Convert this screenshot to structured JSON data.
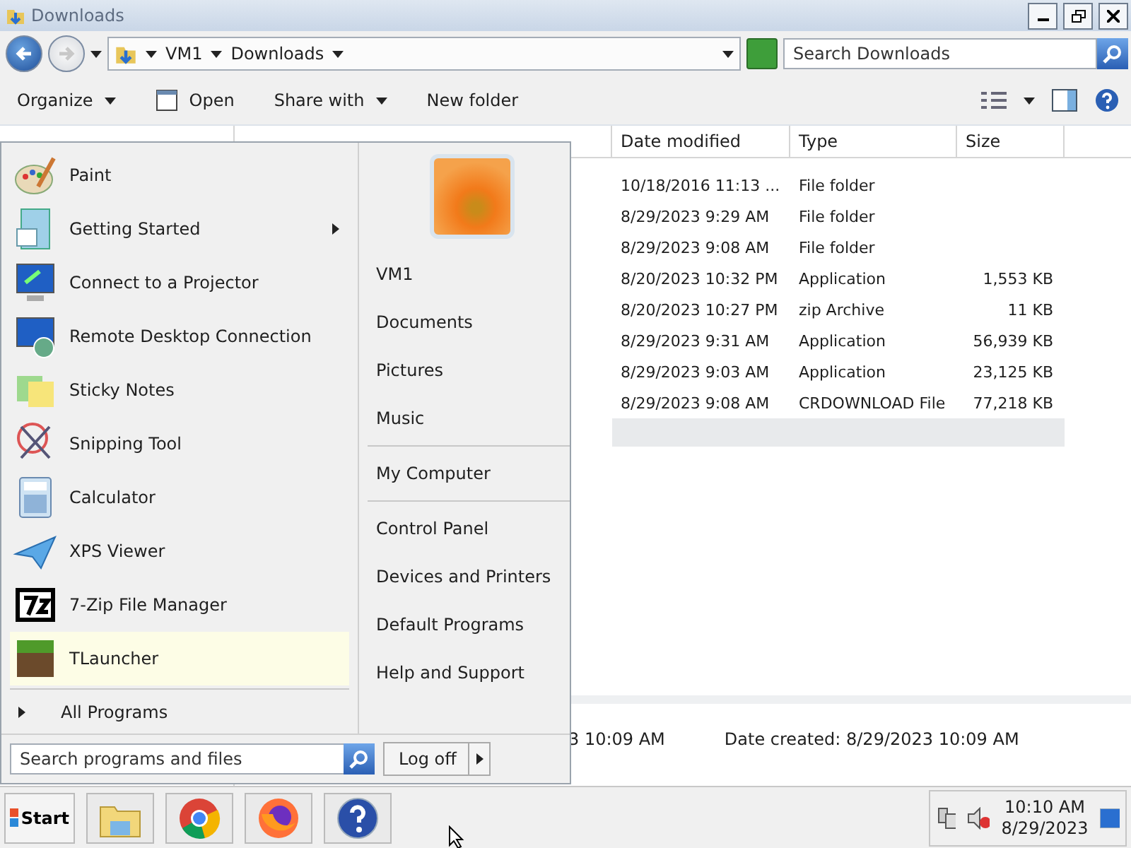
{
  "window": {
    "title": "Downloads"
  },
  "address": {
    "crumbs": [
      "VM1",
      "Downloads"
    ]
  },
  "search": {
    "placeholder": "Search Downloads"
  },
  "toolbar": [
    {
      "label": "Organize",
      "kind": "menu"
    },
    {
      "label": "Open",
      "kind": "icon"
    },
    {
      "label": "Share with",
      "kind": "menu"
    },
    {
      "label": "New folder",
      "kind": "plain"
    }
  ],
  "table": {
    "columns": [
      "Date modified",
      "Type",
      "Size"
    ],
    "rows": [
      {
        "date": "10/18/2016 11:13 ...",
        "type": "File folder",
        "size": ""
      },
      {
        "date": "8/29/2023 9:29 AM",
        "type": "File folder",
        "size": ""
      },
      {
        "date": "8/29/2023 9:08 AM",
        "type": "File folder",
        "size": ""
      },
      {
        "date": "8/20/2023 10:32 PM",
        "type": "Application",
        "size": "1,553 KB"
      },
      {
        "date": "8/20/2023 10:27 PM",
        "type": "zip Archive",
        "size": "11 KB"
      },
      {
        "date": "8/29/2023 9:31 AM",
        "type": "Application",
        "size": "56,939 KB"
      },
      {
        "date": "8/29/2023 9:03 AM",
        "type": "Application",
        "size": "23,125 KB"
      },
      {
        "date": "8/29/2023 9:08 AM",
        "type": "CRDOWNLOAD File",
        "size": "77,218 KB"
      }
    ]
  },
  "details": {
    "modified_tail": "3 10:09 AM",
    "created_label": "Date created:",
    "created_value": "8/29/2023 10:09 AM"
  },
  "start_menu": {
    "programs": [
      {
        "label": "Paint",
        "submenu": false,
        "selected": false
      },
      {
        "label": "Getting Started",
        "submenu": true,
        "selected": false
      },
      {
        "label": "Connect to a Projector",
        "submenu": false,
        "selected": false
      },
      {
        "label": "Remote Desktop Connection",
        "submenu": false,
        "selected": false
      },
      {
        "label": "Sticky Notes",
        "submenu": false,
        "selected": false
      },
      {
        "label": "Snipping Tool",
        "submenu": false,
        "selected": false
      },
      {
        "label": "Calculator",
        "submenu": false,
        "selected": false
      },
      {
        "label": "XPS Viewer",
        "submenu": false,
        "selected": false
      },
      {
        "label": "7-Zip File Manager",
        "submenu": false,
        "selected": false
      },
      {
        "label": "TLauncher",
        "submenu": false,
        "selected": true
      }
    ],
    "all_programs": "All Programs",
    "places": [
      {
        "label": "VM1",
        "divider_above": false
      },
      {
        "label": "Documents",
        "divider_above": false
      },
      {
        "label": "Pictures",
        "divider_above": false
      },
      {
        "label": "Music",
        "divider_above": false
      },
      {
        "label": "My Computer",
        "divider_above": true
      },
      {
        "label": "Control Panel",
        "divider_above": true
      },
      {
        "label": "Devices and Printers",
        "divider_above": false
      },
      {
        "label": "Default Programs",
        "divider_above": false
      },
      {
        "label": "Help and Support",
        "divider_above": false
      }
    ],
    "search_placeholder": "Search programs and files",
    "logoff": "Log off"
  },
  "taskbar": {
    "start": "Start",
    "time": "10:10 AM",
    "date": "8/29/2023"
  }
}
